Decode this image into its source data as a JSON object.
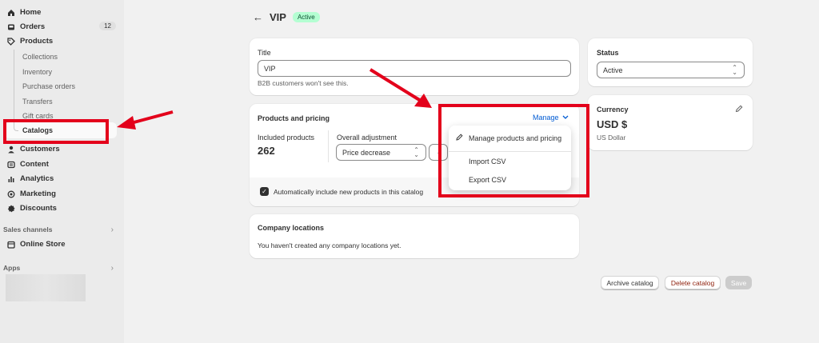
{
  "sidebar": {
    "nav": [
      {
        "label": "Home",
        "icon": "home-icon"
      },
      {
        "label": "Orders",
        "icon": "inbox-icon",
        "badge": "12"
      },
      {
        "label": "Products",
        "icon": "tag-icon"
      }
    ],
    "product_subitems": [
      "Collections",
      "Inventory",
      "Purchase orders",
      "Transfers",
      "Gift cards"
    ],
    "catalogs_label": "Catalogs",
    "nav_after": [
      {
        "label": "Customers",
        "icon": "person-icon"
      },
      {
        "label": "Content",
        "icon": "content-icon"
      },
      {
        "label": "Analytics",
        "icon": "bar-chart-icon"
      },
      {
        "label": "Marketing",
        "icon": "target-icon"
      },
      {
        "label": "Discounts",
        "icon": "discount-icon"
      }
    ],
    "sales_channels_label": "Sales channels",
    "online_store_label": "Online Store",
    "apps_label": "Apps"
  },
  "header": {
    "title": "VIP",
    "status": "Active"
  },
  "title_card": {
    "label": "Title",
    "value": "VIP",
    "helper": "B2B customers won't see this."
  },
  "products_card": {
    "title": "Products and pricing",
    "manage_label": "Manage",
    "included_label": "Included products",
    "included_value": "262",
    "adjustment_label": "Overall adjustment",
    "adjustment_value": "Price decrease",
    "auto_include_label": "Automatically include new products in this catalog",
    "auto_include_checked": true
  },
  "manage_menu": {
    "items": [
      "Manage products and pricing",
      "Import CSV",
      "Export CSV"
    ]
  },
  "locations_card": {
    "title": "Company locations",
    "empty_text": "You haven't created any company locations yet."
  },
  "status_card": {
    "title": "Status",
    "value": "Active"
  },
  "currency_card": {
    "title": "Currency",
    "code": "USD $",
    "name": "US Dollar"
  },
  "footer": {
    "archive_label": "Archive catalog",
    "delete_label": "Delete catalog",
    "save_label": "Save"
  },
  "colors": {
    "annotation_red": "#e3001b",
    "link_blue": "#005bd3",
    "active_green_bg": "#b4fed2"
  }
}
